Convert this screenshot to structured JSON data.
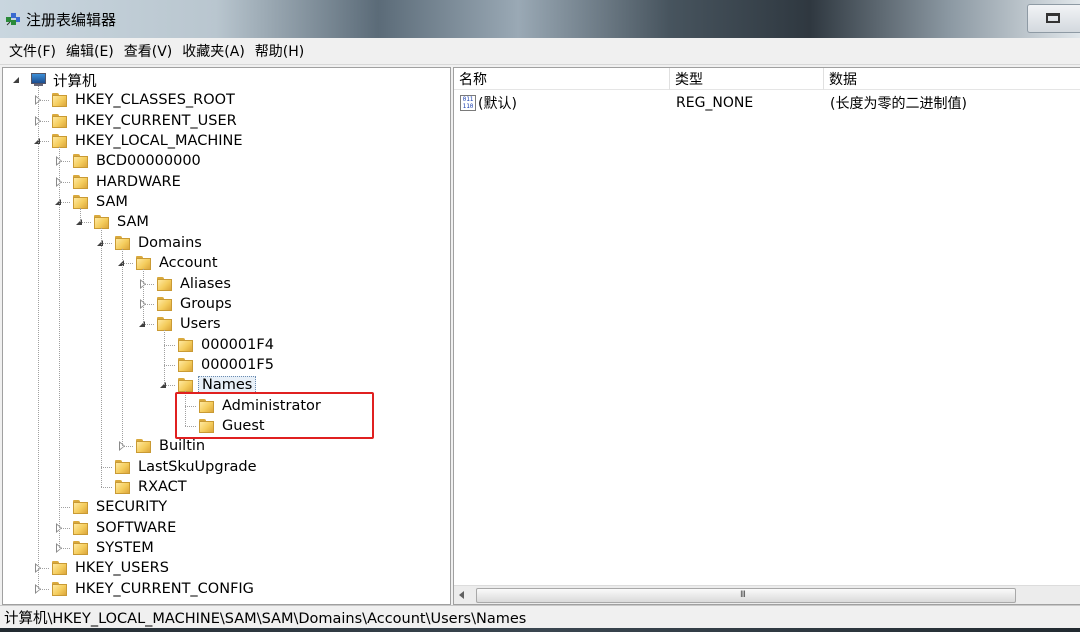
{
  "window": {
    "title": "注册表编辑器"
  },
  "menu": [
    "文件(F)",
    "编辑(E)",
    "查看(V)",
    "收藏夹(A)",
    "帮助(H)"
  ],
  "tree": [
    {
      "label": "计算机",
      "depth": 0,
      "state": "open",
      "kind": "computer"
    },
    {
      "label": "HKEY_CLASSES_ROOT",
      "depth": 1,
      "state": "closed"
    },
    {
      "label": "HKEY_CURRENT_USER",
      "depth": 1,
      "state": "closed"
    },
    {
      "label": "HKEY_LOCAL_MACHINE",
      "depth": 1,
      "state": "open"
    },
    {
      "label": "BCD00000000",
      "depth": 2,
      "state": "closed"
    },
    {
      "label": "HARDWARE",
      "depth": 2,
      "state": "closed"
    },
    {
      "label": "SAM",
      "depth": 2,
      "state": "open"
    },
    {
      "label": "SAM",
      "depth": 3,
      "state": "open"
    },
    {
      "label": "Domains",
      "depth": 4,
      "state": "open"
    },
    {
      "label": "Account",
      "depth": 5,
      "state": "open"
    },
    {
      "label": "Aliases",
      "depth": 6,
      "state": "closed"
    },
    {
      "label": "Groups",
      "depth": 6,
      "state": "closed"
    },
    {
      "label": "Users",
      "depth": 6,
      "state": "open"
    },
    {
      "label": "000001F4",
      "depth": 7,
      "state": "leaf"
    },
    {
      "label": "000001F5",
      "depth": 7,
      "state": "leaf"
    },
    {
      "label": "Names",
      "depth": 7,
      "state": "open",
      "selected": true
    },
    {
      "label": "Administrator",
      "depth": 8,
      "state": "leaf"
    },
    {
      "label": "Guest",
      "depth": 8,
      "state": "leaf"
    },
    {
      "label": "Builtin",
      "depth": 5,
      "state": "closed"
    },
    {
      "label": "LastSkuUpgrade",
      "depth": 4,
      "state": "leaf"
    },
    {
      "label": "RXACT",
      "depth": 4,
      "state": "leaf"
    },
    {
      "label": "SECURITY",
      "depth": 2,
      "state": "leaf"
    },
    {
      "label": "SOFTWARE",
      "depth": 2,
      "state": "closed"
    },
    {
      "label": "SYSTEM",
      "depth": 2,
      "state": "closed"
    },
    {
      "label": "HKEY_USERS",
      "depth": 1,
      "state": "closed"
    },
    {
      "label": "HKEY_CURRENT_CONFIG",
      "depth": 1,
      "state": "closed"
    }
  ],
  "list": {
    "columns": [
      "名称",
      "类型",
      "数据"
    ],
    "rows": [
      {
        "name": "(默认)",
        "type": "REG_NONE",
        "data": "(长度为零的二进制值)",
        "icon": "binary-value-icon",
        "icon_text": "011\n110"
      }
    ]
  },
  "scrollbar_grip": "III",
  "status": "计算机\\HKEY_LOCAL_MACHINE\\SAM\\SAM\\Domains\\Account\\Users\\Names",
  "highlight_color": "#e02020"
}
